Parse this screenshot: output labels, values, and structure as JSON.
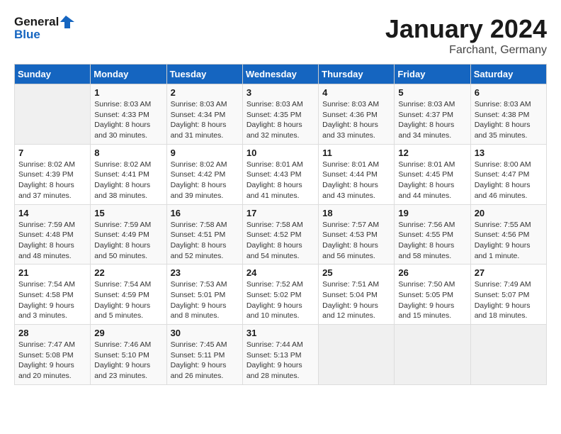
{
  "header": {
    "logo_line1": "General",
    "logo_line2": "Blue",
    "month": "January 2024",
    "location": "Farchant, Germany"
  },
  "days_of_week": [
    "Sunday",
    "Monday",
    "Tuesday",
    "Wednesday",
    "Thursday",
    "Friday",
    "Saturday"
  ],
  "weeks": [
    [
      {
        "day": "",
        "sunrise": "",
        "sunset": "",
        "daylight": ""
      },
      {
        "day": "1",
        "sunrise": "Sunrise: 8:03 AM",
        "sunset": "Sunset: 4:33 PM",
        "daylight": "Daylight: 8 hours and 30 minutes."
      },
      {
        "day": "2",
        "sunrise": "Sunrise: 8:03 AM",
        "sunset": "Sunset: 4:34 PM",
        "daylight": "Daylight: 8 hours and 31 minutes."
      },
      {
        "day": "3",
        "sunrise": "Sunrise: 8:03 AM",
        "sunset": "Sunset: 4:35 PM",
        "daylight": "Daylight: 8 hours and 32 minutes."
      },
      {
        "day": "4",
        "sunrise": "Sunrise: 8:03 AM",
        "sunset": "Sunset: 4:36 PM",
        "daylight": "Daylight: 8 hours and 33 minutes."
      },
      {
        "day": "5",
        "sunrise": "Sunrise: 8:03 AM",
        "sunset": "Sunset: 4:37 PM",
        "daylight": "Daylight: 8 hours and 34 minutes."
      },
      {
        "day": "6",
        "sunrise": "Sunrise: 8:03 AM",
        "sunset": "Sunset: 4:38 PM",
        "daylight": "Daylight: 8 hours and 35 minutes."
      }
    ],
    [
      {
        "day": "7",
        "sunrise": "Sunrise: 8:02 AM",
        "sunset": "Sunset: 4:39 PM",
        "daylight": "Daylight: 8 hours and 37 minutes."
      },
      {
        "day": "8",
        "sunrise": "Sunrise: 8:02 AM",
        "sunset": "Sunset: 4:41 PM",
        "daylight": "Daylight: 8 hours and 38 minutes."
      },
      {
        "day": "9",
        "sunrise": "Sunrise: 8:02 AM",
        "sunset": "Sunset: 4:42 PM",
        "daylight": "Daylight: 8 hours and 39 minutes."
      },
      {
        "day": "10",
        "sunrise": "Sunrise: 8:01 AM",
        "sunset": "Sunset: 4:43 PM",
        "daylight": "Daylight: 8 hours and 41 minutes."
      },
      {
        "day": "11",
        "sunrise": "Sunrise: 8:01 AM",
        "sunset": "Sunset: 4:44 PM",
        "daylight": "Daylight: 8 hours and 43 minutes."
      },
      {
        "day": "12",
        "sunrise": "Sunrise: 8:01 AM",
        "sunset": "Sunset: 4:45 PM",
        "daylight": "Daylight: 8 hours and 44 minutes."
      },
      {
        "day": "13",
        "sunrise": "Sunrise: 8:00 AM",
        "sunset": "Sunset: 4:47 PM",
        "daylight": "Daylight: 8 hours and 46 minutes."
      }
    ],
    [
      {
        "day": "14",
        "sunrise": "Sunrise: 7:59 AM",
        "sunset": "Sunset: 4:48 PM",
        "daylight": "Daylight: 8 hours and 48 minutes."
      },
      {
        "day": "15",
        "sunrise": "Sunrise: 7:59 AM",
        "sunset": "Sunset: 4:49 PM",
        "daylight": "Daylight: 8 hours and 50 minutes."
      },
      {
        "day": "16",
        "sunrise": "Sunrise: 7:58 AM",
        "sunset": "Sunset: 4:51 PM",
        "daylight": "Daylight: 8 hours and 52 minutes."
      },
      {
        "day": "17",
        "sunrise": "Sunrise: 7:58 AM",
        "sunset": "Sunset: 4:52 PM",
        "daylight": "Daylight: 8 hours and 54 minutes."
      },
      {
        "day": "18",
        "sunrise": "Sunrise: 7:57 AM",
        "sunset": "Sunset: 4:53 PM",
        "daylight": "Daylight: 8 hours and 56 minutes."
      },
      {
        "day": "19",
        "sunrise": "Sunrise: 7:56 AM",
        "sunset": "Sunset: 4:55 PM",
        "daylight": "Daylight: 8 hours and 58 minutes."
      },
      {
        "day": "20",
        "sunrise": "Sunrise: 7:55 AM",
        "sunset": "Sunset: 4:56 PM",
        "daylight": "Daylight: 9 hours and 1 minute."
      }
    ],
    [
      {
        "day": "21",
        "sunrise": "Sunrise: 7:54 AM",
        "sunset": "Sunset: 4:58 PM",
        "daylight": "Daylight: 9 hours and 3 minutes."
      },
      {
        "day": "22",
        "sunrise": "Sunrise: 7:54 AM",
        "sunset": "Sunset: 4:59 PM",
        "daylight": "Daylight: 9 hours and 5 minutes."
      },
      {
        "day": "23",
        "sunrise": "Sunrise: 7:53 AM",
        "sunset": "Sunset: 5:01 PM",
        "daylight": "Daylight: 9 hours and 8 minutes."
      },
      {
        "day": "24",
        "sunrise": "Sunrise: 7:52 AM",
        "sunset": "Sunset: 5:02 PM",
        "daylight": "Daylight: 9 hours and 10 minutes."
      },
      {
        "day": "25",
        "sunrise": "Sunrise: 7:51 AM",
        "sunset": "Sunset: 5:04 PM",
        "daylight": "Daylight: 9 hours and 12 minutes."
      },
      {
        "day": "26",
        "sunrise": "Sunrise: 7:50 AM",
        "sunset": "Sunset: 5:05 PM",
        "daylight": "Daylight: 9 hours and 15 minutes."
      },
      {
        "day": "27",
        "sunrise": "Sunrise: 7:49 AM",
        "sunset": "Sunset: 5:07 PM",
        "daylight": "Daylight: 9 hours and 18 minutes."
      }
    ],
    [
      {
        "day": "28",
        "sunrise": "Sunrise: 7:47 AM",
        "sunset": "Sunset: 5:08 PM",
        "daylight": "Daylight: 9 hours and 20 minutes."
      },
      {
        "day": "29",
        "sunrise": "Sunrise: 7:46 AM",
        "sunset": "Sunset: 5:10 PM",
        "daylight": "Daylight: 9 hours and 23 minutes."
      },
      {
        "day": "30",
        "sunrise": "Sunrise: 7:45 AM",
        "sunset": "Sunset: 5:11 PM",
        "daylight": "Daylight: 9 hours and 26 minutes."
      },
      {
        "day": "31",
        "sunrise": "Sunrise: 7:44 AM",
        "sunset": "Sunset: 5:13 PM",
        "daylight": "Daylight: 9 hours and 28 minutes."
      },
      {
        "day": "",
        "sunrise": "",
        "sunset": "",
        "daylight": ""
      },
      {
        "day": "",
        "sunrise": "",
        "sunset": "",
        "daylight": ""
      },
      {
        "day": "",
        "sunrise": "",
        "sunset": "",
        "daylight": ""
      }
    ]
  ]
}
